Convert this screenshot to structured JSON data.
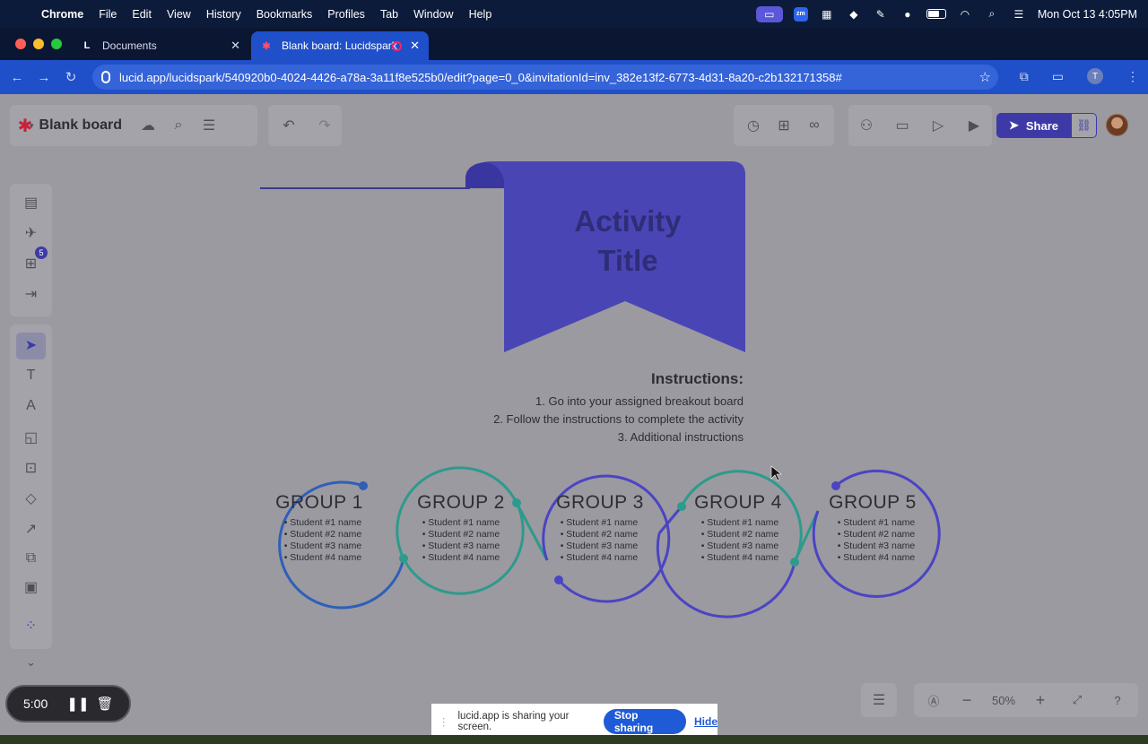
{
  "menubar": {
    "app": "Chrome",
    "items": [
      "File",
      "Edit",
      "View",
      "History",
      "Bookmarks",
      "Profiles",
      "Tab",
      "Window",
      "Help"
    ],
    "zoom_badge": "zm",
    "clock": "Mon Oct 13  4:05PM"
  },
  "tabs": [
    {
      "title": "Documents",
      "icon": "lucid-icon"
    },
    {
      "title": "Blank board: Lucidspark",
      "icon": "lucidspark-icon"
    }
  ],
  "address": {
    "url": "lucid.app/lucidspark/540920b0-4024-4426-a78a-3a11f8e525b0/edit?page=0_0&invitationId=inv_382e13f2-6773-4d31-8a20-c2b132171358#",
    "profile_initial": "T"
  },
  "board": {
    "title": "Blank board",
    "share_label": "Share",
    "panel_badge": "5"
  },
  "canvas": {
    "banner_title_line1": "Activity",
    "banner_title_line2": "Title",
    "instructions_heading": "Instructions:",
    "instructions": [
      "1.  Go into your assigned breakout board",
      "2.  Follow the instructions to complete the activity",
      "3.  Additional instructions"
    ],
    "groups": [
      {
        "title": "GROUP 1",
        "students": [
          "• Student #1 name",
          "• Student #2 name",
          "• Student #3 name",
          "• Student #4 name"
        ]
      },
      {
        "title": "GROUP 2",
        "students": [
          "• Student #1 name",
          "• Student #2 name",
          "• Student #3 name",
          "• Student #4 name"
        ]
      },
      {
        "title": "GROUP 3",
        "students": [
          "• Student #1 name",
          "• Student #2 name",
          "• Student #3 name",
          "• Student #4 name"
        ]
      },
      {
        "title": "GROUP 4",
        "students": [
          "• Student #1 name",
          "• Student #2 name",
          "• Student #3 name",
          "• Student #4 name"
        ]
      },
      {
        "title": "GROUP 5",
        "students": [
          "• Student #1 name",
          "• Student #2 name",
          "• Student #3 name",
          "• Student #4 name"
        ]
      }
    ],
    "colors": {
      "banner": "#4a45b5",
      "blue": "#2f5fb8",
      "teal": "#2d9a8c",
      "purple": "#4b44c4"
    }
  },
  "zoom": {
    "level": "50%"
  },
  "timer": {
    "time": "5:00"
  },
  "screen_share": {
    "message": "lucid.app is sharing your screen.",
    "stop_label": "Stop sharing",
    "hide_label": "Hide"
  }
}
